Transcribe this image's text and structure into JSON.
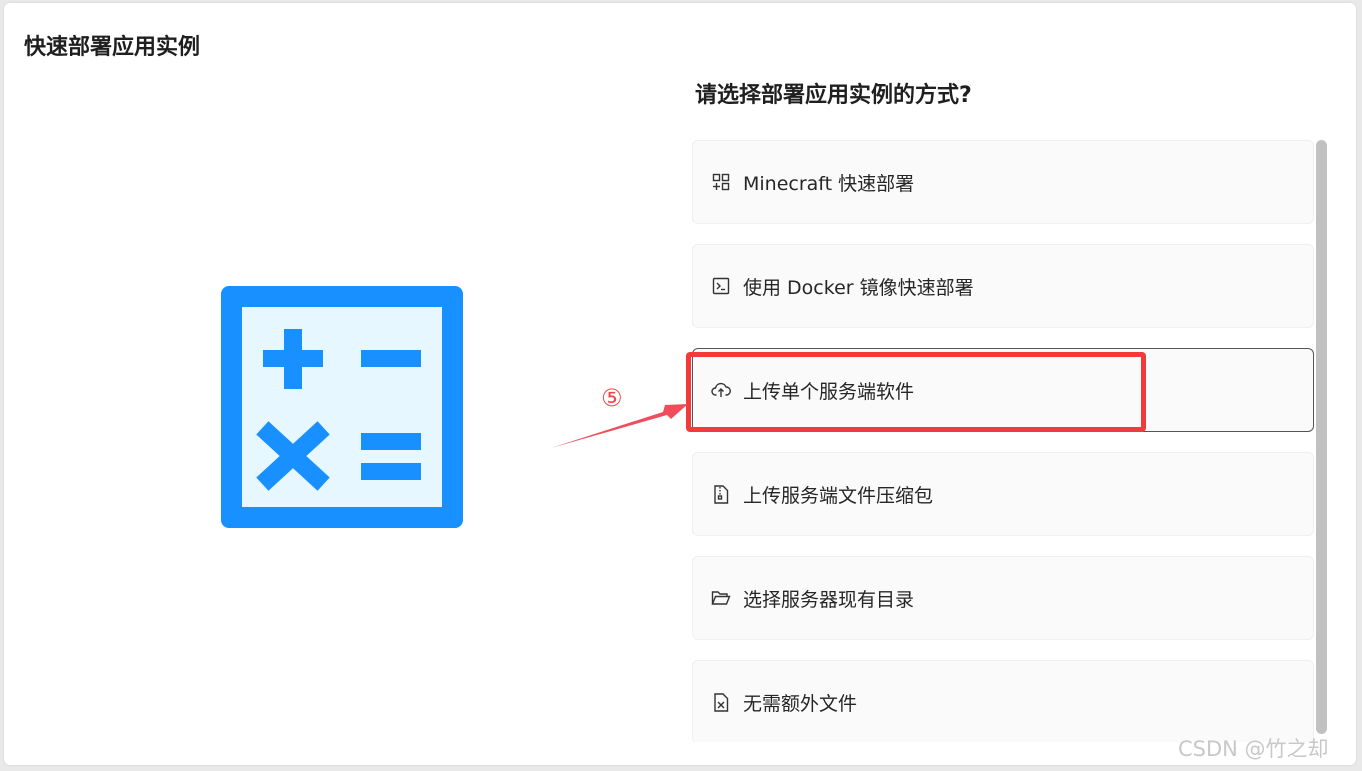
{
  "dialog": {
    "title": "快速部署应用实例",
    "question": "请选择部署应用实例的方式?"
  },
  "options": [
    {
      "label": "Minecraft 快速部署",
      "icon": "app-grid-icon"
    },
    {
      "label": "使用 Docker 镜像快速部署",
      "icon": "terminal-icon"
    },
    {
      "label": "上传单个服务端软件",
      "icon": "cloud-upload-icon",
      "selected": true
    },
    {
      "label": "上传服务端文件压缩包",
      "icon": "zip-file-icon"
    },
    {
      "label": "选择服务器现有目录",
      "icon": "folder-open-icon"
    },
    {
      "label": "无需额外文件",
      "icon": "file-excel-icon"
    }
  ],
  "annotation": {
    "step": "⑤",
    "color": "#f23a3a"
  },
  "illustration": {
    "icon": "calculator-icon",
    "color": "#1890ff",
    "fill": "#e6f7ff"
  },
  "watermark": "CSDN @竹之却"
}
